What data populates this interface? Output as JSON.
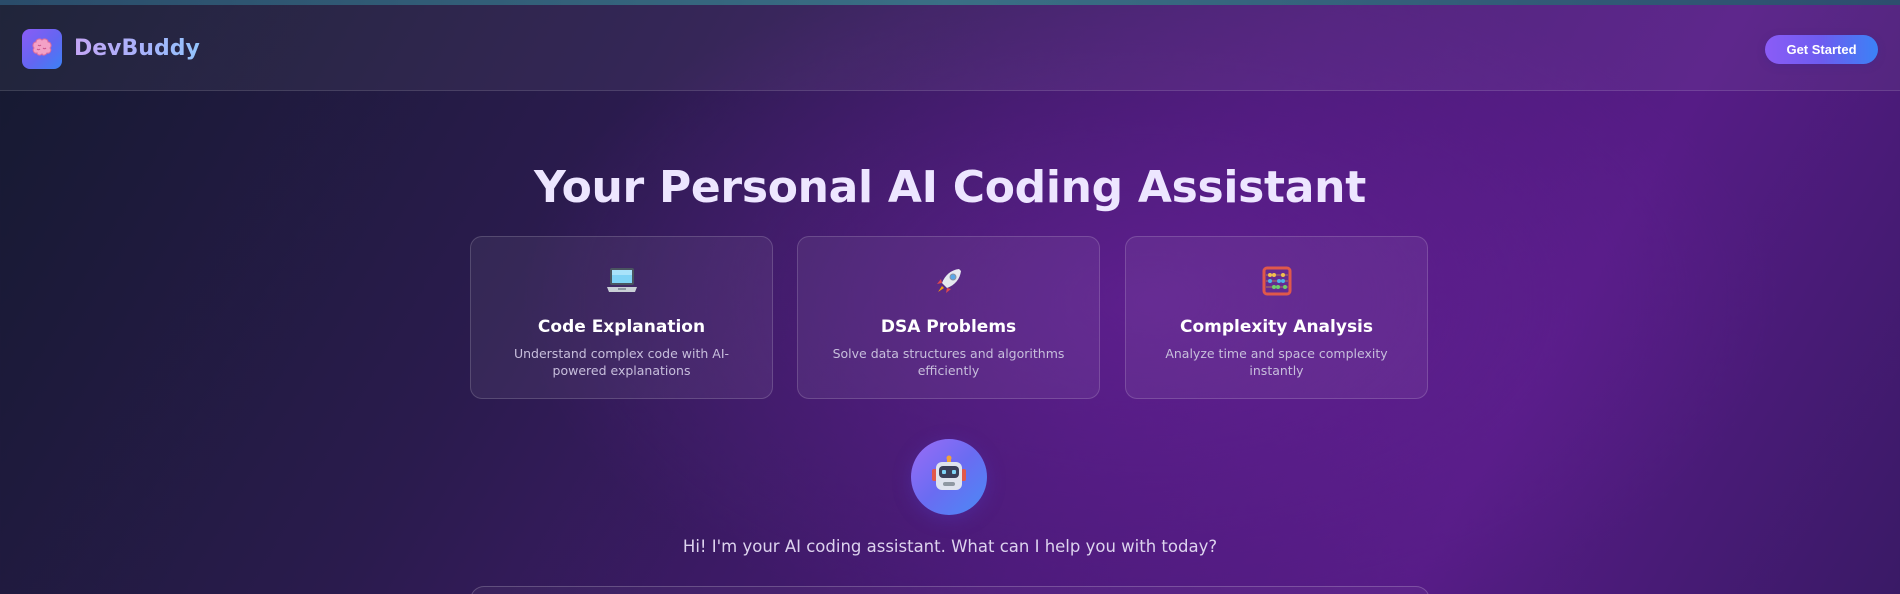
{
  "app": {
    "brand": "DevBuddy",
    "cta_label": "Get Started"
  },
  "hero": {
    "title": "Your Personal AI Coding Assistant"
  },
  "features": [
    {
      "icon": "laptop-icon",
      "title": "Code Explanation",
      "desc": "Understand complex code with AI-powered explanations"
    },
    {
      "icon": "rocket-icon",
      "title": "DSA Problems",
      "desc": "Solve data structures and algorithms efficiently"
    },
    {
      "icon": "abacus-icon",
      "title": "Complexity Analysis",
      "desc": "Analyze time and space complexity instantly"
    }
  ],
  "assistant": {
    "icon": "robot-icon",
    "greeting": "Hi! I'm your AI coding assistant. What can I help you with today?"
  },
  "colors": {
    "accent_purple": "#8b5cf6",
    "accent_blue": "#3b82f6",
    "bg_dark": "#151a30",
    "bg_purple": "#561c86"
  }
}
